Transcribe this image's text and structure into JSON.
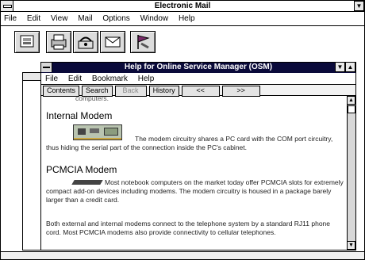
{
  "app": {
    "title": "Electronic Mail"
  },
  "menu": [
    "File",
    "Edit",
    "View",
    "Mail",
    "Options",
    "Window",
    "Help"
  ],
  "toolbar_icons": [
    "mailbox-icon",
    "printer-icon",
    "phone-icon",
    "read-mail-icon",
    "flag-icon"
  ],
  "help": {
    "title": "Help for Online Service Manager (OSM)",
    "menu": [
      "File",
      "Edit",
      "Bookmark",
      "Help"
    ],
    "buttons": [
      "Contents",
      "Search",
      "Back",
      "History",
      "<<",
      ">>"
    ],
    "partial_line": "computers.",
    "sections": [
      {
        "heading": "Internal Modem",
        "body": "The modem circuitry shares a PC card with the COM port circuitry, thus hiding the serial part of the connection inside the PC's cabinet."
      },
      {
        "heading": "PCMCIA Modem",
        "body": "Most notebook computers on the market today offer PCMCIA slots for extremely compact add-on devices including modems.  The modem circuitry is housed in a package barely larger than a credit card."
      }
    ],
    "footer": "Both external and internal modems connect to the telephone system by a standard RJ11 phone cord.  Most PCMCIA modems also provide connectivity to cellular telephones."
  }
}
